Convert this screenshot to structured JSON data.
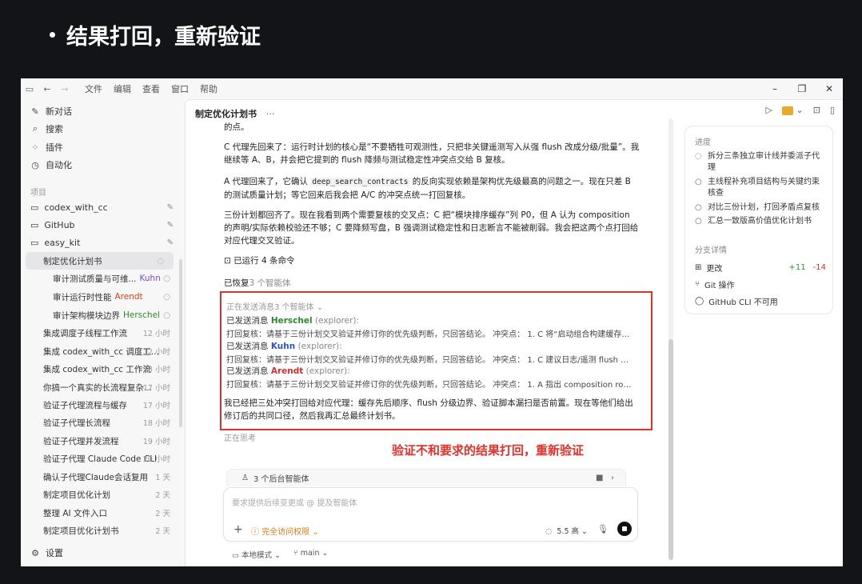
{
  "slide": {
    "title": "结果打回，重新验证"
  },
  "annotation": "验证不和要求的结果打回，重新验证",
  "titlebar": {
    "menus": [
      "文件",
      "编辑",
      "查看",
      "窗口",
      "帮助"
    ],
    "controls": [
      "–",
      "❐",
      "✕"
    ]
  },
  "sidebar": {
    "top": [
      {
        "icon": "✎",
        "label": "新对话"
      },
      {
        "icon": "⌕",
        "label": "搜索"
      },
      {
        "icon": "⁘",
        "label": "插件"
      },
      {
        "icon": "◷",
        "label": "自动化"
      }
    ],
    "section": "项目",
    "projects": [
      {
        "label": "codex_with_cc"
      },
      {
        "label": "GitHub"
      },
      {
        "label": "easy_kit"
      }
    ],
    "active_thread": "制定优化计划书",
    "subagents": [
      {
        "label": "审计测试质量与可维...",
        "agent": "Kuhn"
      },
      {
        "label": "审计运行时性能",
        "agent": "Arendt"
      },
      {
        "label": "审计架构模块边界",
        "agent": "Herschel"
      }
    ],
    "threads": [
      {
        "label": "集成调度子线程工作流",
        "time": "12 小时"
      },
      {
        "label": "集成 codex_with_cc 调度工...",
        "time": "12 小时"
      },
      {
        "label": "集成 codex_with_cc 工作流",
        "time": "13 小时"
      },
      {
        "label": "你搞一个真实的长流程复杂...",
        "time": "17 小时"
      },
      {
        "label": "验证子代理流程与缓存",
        "time": "17 小时"
      },
      {
        "label": "验证子代理长流程",
        "time": "18 小时"
      },
      {
        "label": "验证子代理并发流程",
        "time": "19 小时"
      },
      {
        "label": "验证子代理 Claude Code CLI",
        "time": "20 小时"
      },
      {
        "label": "确认子代理Claude会话复用",
        "time": "1 天"
      },
      {
        "label": "制定项目优化计划",
        "time": "2 天"
      },
      {
        "label": "整理 AI 文件入口",
        "time": "2 天"
      },
      {
        "label": "制定项目优化计划书",
        "time": "2 天"
      }
    ],
    "settings": "设置"
  },
  "main": {
    "title": "制定优化计划书",
    "more": "···",
    "msg_cut": "的点。",
    "msg1": "C 代理先回来了：运行时计划的核心是“不要牺牲可观测性，只把非关键遥测写入从强 flush 改成分级/批量”。我继续等 A、B，并会把它提到的 flush 降频与测试稳定性冲突点交给 B 复核。",
    "msg2_pre": "A 代理回来了，它确认 ",
    "msg2_code": "deep_search_contracts",
    "msg2_post": " 的反向实现依赖是架构优先级最高的问题之一。现在只差 B 的测试质量计划；等它回来后我会把 A/C 的冲突点统一打回复核。",
    "msg3": "三份计划都回齐了。现在我看到两个需要复核的交叉点：C 把“模块排序缓存”列 P0，但 A 认为 composition 的声明/实际依赖校验还不够；C 要降频写盘，B 强调测试稳定性和日志断言不能被削弱。我会把这两个点打回给对应代理交叉验证。",
    "ran": "已运行 4 条命令",
    "restored_pre": "已恢复",
    "restored_post": "3 个智能体",
    "sending": "正在发送消息3 个智能体 ⌄",
    "sent_label": "已发送消息",
    "sent": [
      {
        "name": "Herschel",
        "role": "(explorer):",
        "text": "打回复核：请基于三份计划交叉验证并修订你的优先级判断，只回答结论。 冲突点： 1. C 将“启动组合构建缓存模块..."
      },
      {
        "name": "Kuhn",
        "role": "(explorer):",
        "text": "打回复核：请基于三份计划交叉验证并修订你的优先级判断，只回答结论。 冲突点： 1. C 建议日志/遥测 flush 降频。..."
      },
      {
        "name": "Arendt",
        "role": "(explorer):",
        "text": "打回复核：请基于三份计划交叉验证并修订你的优先级判断，只回答结论。 冲突点： 1. A 指出 composition root 缺少..."
      }
    ],
    "summary": "我已经把三处冲突打回给对应代理：缓存先后顺序、flush 分级边界、验证脚本漏扫是否前置。现在等他们给出修订后的共同口径，然后我再汇总最终计划书。",
    "thinking": "正在思考",
    "bg_agents": "3 个后台智能体",
    "composer": {
      "placeholder": "要求提供后续变更或 @ 提及智能体",
      "permission": "完全访问权限",
      "model": "5.5 高"
    },
    "footer": {
      "mode": "本地模式",
      "branch": "main"
    }
  },
  "right_panel": {
    "progress_title": "进度",
    "tasks": [
      {
        "mark": "◌",
        "text": "拆分三条独立审计线并委派子代理"
      },
      {
        "mark": "○",
        "text": "主线程补充项目结构与关键约束核查"
      },
      {
        "mark": "○",
        "text": "对比三份计划，打回矛盾点复核"
      },
      {
        "mark": "○",
        "text": "汇总一致版高价值优化计划书"
      }
    ],
    "branch_title": "分支详情",
    "changes_label": "更改",
    "additions": "+11",
    "deletions": "-14",
    "git_label": "Git 操作",
    "gh_label": "GitHub CLI 不可用"
  }
}
